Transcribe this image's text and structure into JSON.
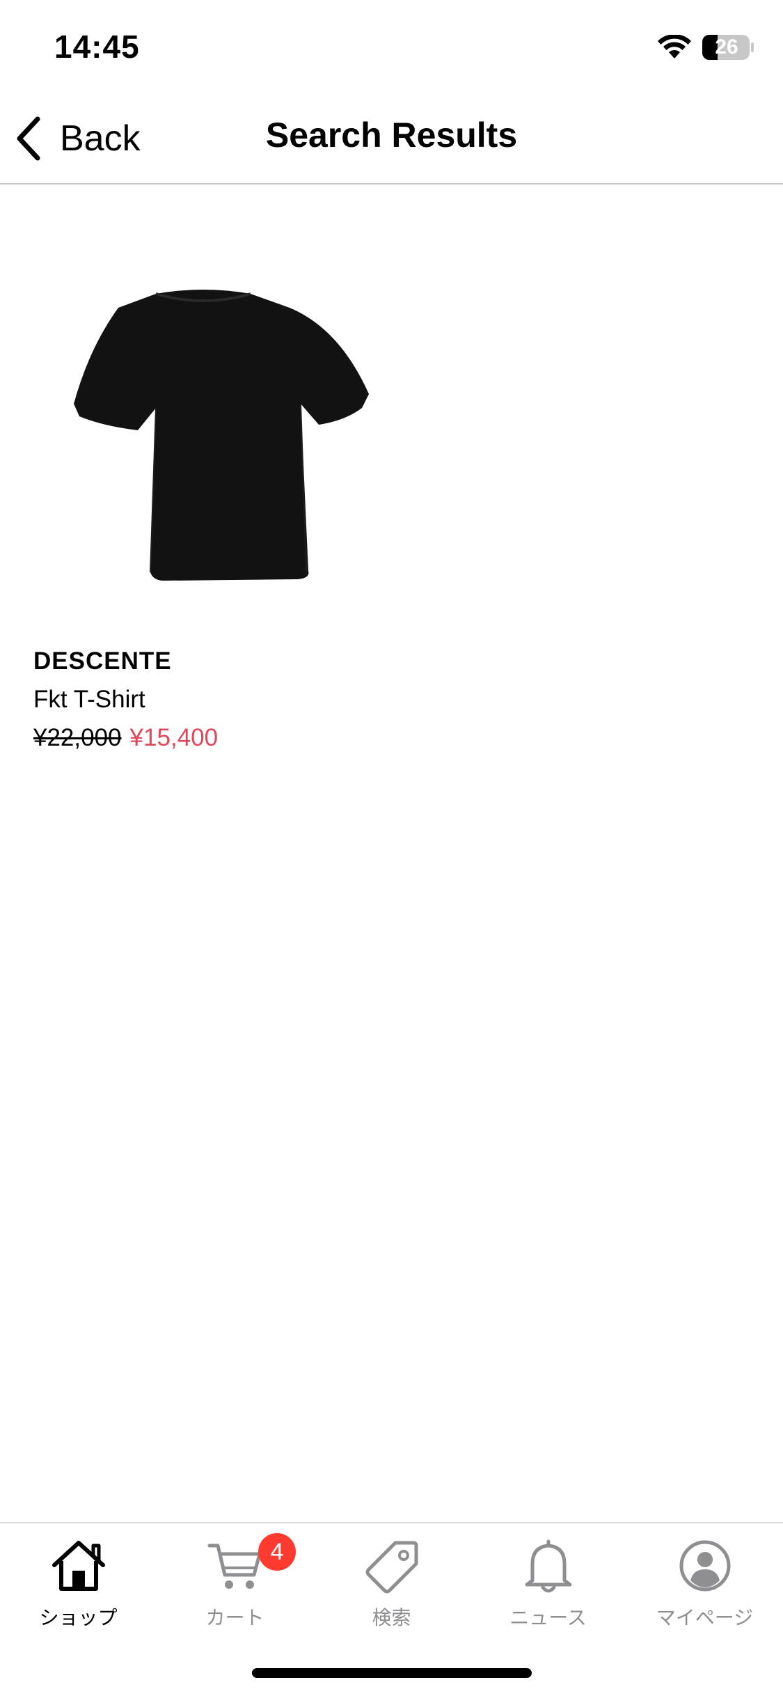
{
  "status_bar": {
    "time": "14:45",
    "battery": "26"
  },
  "nav": {
    "back_label": "Back",
    "title": "Search Results"
  },
  "results": [
    {
      "brand": "DESCENTE",
      "name": "Fkt T-Shirt",
      "original_price": "¥22,000",
      "sale_price": "¥15,400",
      "image_icon": "black-tshirt-image"
    }
  ],
  "tab_bar": {
    "tabs": [
      {
        "label": "ショップ",
        "icon": "home-icon",
        "active": true
      },
      {
        "label": "カート",
        "icon": "cart-icon",
        "badge": "4"
      },
      {
        "label": "検索",
        "icon": "tag-icon"
      },
      {
        "label": "ニュース",
        "icon": "bell-icon"
      },
      {
        "label": "マイページ",
        "icon": "profile-icon"
      }
    ]
  },
  "colors": {
    "sale_price": "#e0485a",
    "badge": "#ff3b30",
    "inactive_tab": "#8e8e93"
  }
}
